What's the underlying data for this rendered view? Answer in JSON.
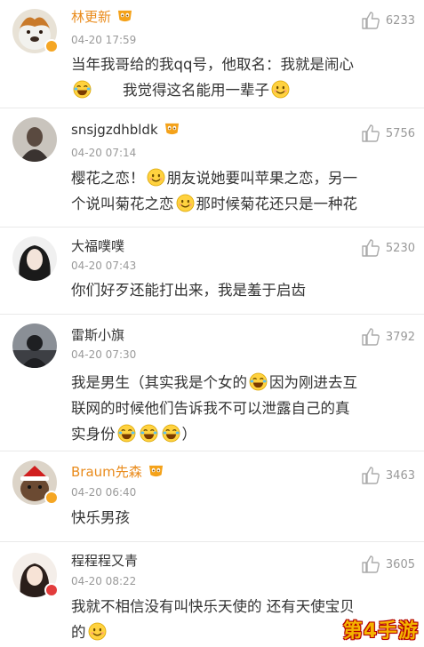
{
  "comments": [
    {
      "name": "林更新",
      "time": "04-20 17:59",
      "likes": "6233",
      "line1": "当年我哥给的我qq号，他取名：我就是闹心",
      "line2": "我觉得这名能用一辈子"
    },
    {
      "name": "snsjgzdhbldk",
      "time": "04-20 07:14",
      "likes": "5756",
      "line1a": "樱花之恋！",
      "line1b": "朋友说她要叫苹果之恋，另一",
      "line2a": "个说叫菊花之恋",
      "line2b": "那时候菊花还只是一种花"
    },
    {
      "name": "大福噗噗",
      "time": "04-20 07:43",
      "likes": "5230",
      "line1": "你们好歹还能打出来，我是羞于启齿"
    },
    {
      "name": "雷斯小旗",
      "time": "04-20 07:30",
      "likes": "3792",
      "line1a": "我是男生（其实我是个女的",
      "line1b": "因为刚进去互",
      "line2": "联网的时候他们告诉我不可以泄露自己的真",
      "line3a": "实身份",
      "line3b": "）"
    },
    {
      "name": "Braum先森",
      "time": "04-20 06:40",
      "likes": "3463",
      "line1": "快乐男孩"
    },
    {
      "name": "程程程又青",
      "time": "04-20 08:22",
      "likes": "3605",
      "line1": "我就不相信没有叫快乐天使的 还有天使宝贝",
      "line2": "的"
    }
  ],
  "watermark": "第4手游",
  "colors": {
    "name_orange": "#e98b1c",
    "vip_badge": "#f5a623",
    "divider": "#e9e9e9"
  },
  "icons": [
    "thumbs-up-icon",
    "crying-laughing-emoji",
    "grinning-emoji",
    "vip-level-badge"
  ]
}
